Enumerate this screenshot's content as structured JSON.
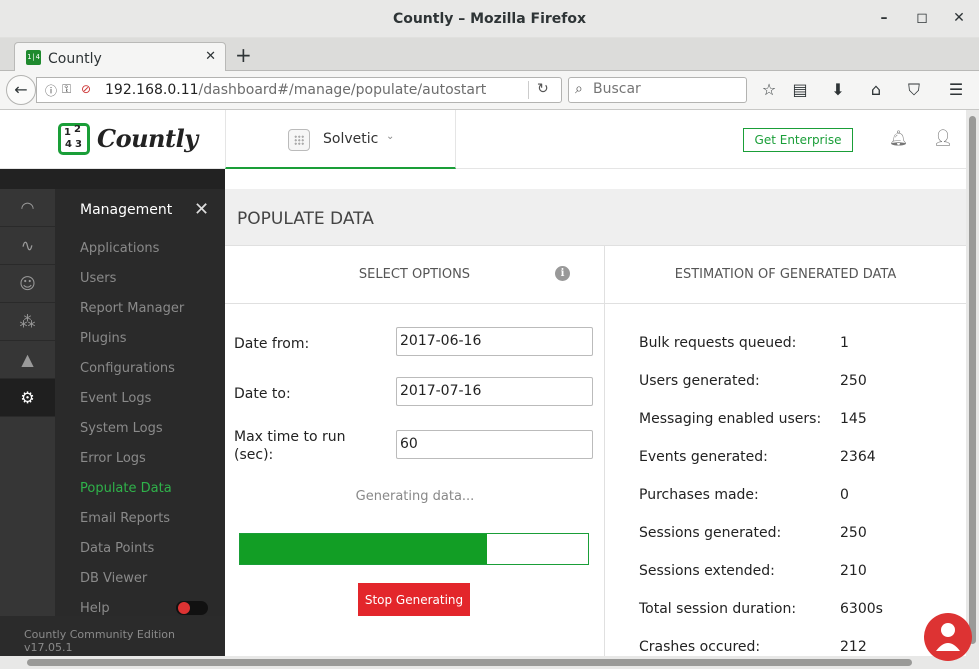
{
  "window": {
    "title": "Countly – Mozilla Firefox"
  },
  "tab": {
    "label": "Countly",
    "favicon_text": "1|4"
  },
  "address_bar": {
    "host": "192.168.0.11",
    "path": "/dashboard#/manage/populate/autostart"
  },
  "search_bar": {
    "placeholder": "Buscar"
  },
  "header": {
    "logo_text": "Countly",
    "app_name": "Solvetic",
    "enterprise_button": "Get Enterprise"
  },
  "sidebar": {
    "menu_title": "Management",
    "items": [
      {
        "label": "Applications"
      },
      {
        "label": "Users"
      },
      {
        "label": "Report Manager"
      },
      {
        "label": "Plugins"
      },
      {
        "label": "Configurations"
      },
      {
        "label": "Event Logs"
      },
      {
        "label": "System Logs"
      },
      {
        "label": "Error Logs"
      },
      {
        "label": "Populate Data",
        "active": true
      },
      {
        "label": "Email Reports"
      },
      {
        "label": "Data Points"
      },
      {
        "label": "DB Viewer"
      },
      {
        "label": "Help"
      }
    ],
    "edition": "Countly Community Edition v17.05.1"
  },
  "page": {
    "title": "POPULATE DATA",
    "left_panel": {
      "heading": "SELECT OPTIONS",
      "date_from_label": "Date from:",
      "date_from_value": "2017-06-16",
      "date_to_label": "Date to:",
      "date_to_value": "2017-07-16",
      "max_time_label": "Max time to run (sec):",
      "max_time_value": "60",
      "status": "Generating data...",
      "progress_fraction": 0.71,
      "stop_button": "Stop Generating"
    },
    "right_panel": {
      "heading": "ESTIMATION OF GENERATED DATA",
      "stats": [
        {
          "label": "Bulk requests queued:",
          "value": "1"
        },
        {
          "label": "Users generated:",
          "value": "250"
        },
        {
          "label": "Messaging enabled users:",
          "value": "145"
        },
        {
          "label": "Events generated:",
          "value": "2364"
        },
        {
          "label": "Purchases made:",
          "value": "0"
        },
        {
          "label": "Sessions generated:",
          "value": "250"
        },
        {
          "label": "Sessions extended:",
          "value": "210"
        },
        {
          "label": "Total session duration:",
          "value": "6300s"
        },
        {
          "label": "Crashes occured:",
          "value": "212"
        }
      ]
    }
  },
  "colors": {
    "brand_green": "#1a9e38",
    "danger_red": "#e3262b",
    "sidebar_bg": "#2a2a2a"
  }
}
